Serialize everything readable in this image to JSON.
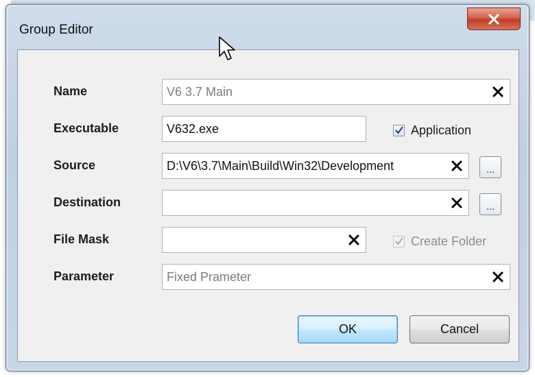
{
  "window": {
    "title": "Group Editor"
  },
  "fields": {
    "name": {
      "label": "Name",
      "value": "V6 3.7 Main"
    },
    "executable": {
      "label": "Executable",
      "value": "V632.exe"
    },
    "source": {
      "label": "Source",
      "value": "D:\\V6\\3.7\\Main\\Build\\Win32\\Development"
    },
    "destination": {
      "label": "Destination",
      "value": ""
    },
    "file_mask": {
      "label": "File Mask",
      "value": ""
    },
    "parameter": {
      "label": "Parameter",
      "placeholder": "Fixed Prameter",
      "value": ""
    }
  },
  "checkboxes": {
    "application": {
      "label": "Application",
      "checked": true
    },
    "create_folder": {
      "label": "Create Folder",
      "checked": true,
      "disabled": true
    }
  },
  "browse_label": "...",
  "buttons": {
    "ok": "OK",
    "cancel": "Cancel"
  },
  "colors": {
    "close_button": "#c8432d",
    "ok_border": "#3c7fb1",
    "dialog_bg": "#f0f0f0"
  }
}
